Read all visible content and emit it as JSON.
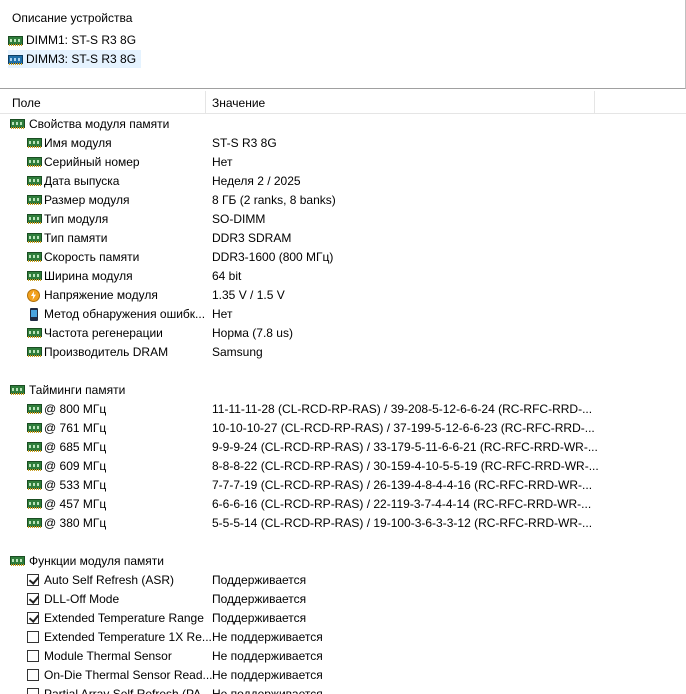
{
  "devices_panel": {
    "title": "Описание устройства",
    "devices": [
      {
        "label": "DIMM1: ST-S R3 8G",
        "selected": false
      },
      {
        "label": "DIMM3: ST-S R3 8G",
        "selected": true
      }
    ]
  },
  "columns": {
    "field": "Поле",
    "value": "Значение"
  },
  "sections": [
    {
      "title": "Свойства модуля памяти",
      "rows": [
        {
          "field": "Имя модуля",
          "value": "ST-S R3 8G",
          "icon": "ram"
        },
        {
          "field": "Серийный номер",
          "value": "Нет",
          "icon": "ram"
        },
        {
          "field": "Дата выпуска",
          "value": "Неделя 2 / 2025",
          "icon": "ram"
        },
        {
          "field": "Размер модуля",
          "value": "8 ГБ (2 ranks, 8 banks)",
          "icon": "ram"
        },
        {
          "field": "Тип модуля",
          "value": "SO-DIMM",
          "icon": "ram"
        },
        {
          "field": "Тип памяти",
          "value": "DDR3 SDRAM",
          "icon": "ram"
        },
        {
          "field": "Скорость памяти",
          "value": "DDR3-1600 (800 МГц)",
          "icon": "ram"
        },
        {
          "field": "Ширина модуля",
          "value": "64 bit",
          "icon": "ram"
        },
        {
          "field": "Напряжение модуля",
          "value": "1.35 V / 1.5 V",
          "icon": "voltage"
        },
        {
          "field": "Метод обнаружения ошибк...",
          "value": "Нет",
          "icon": "device"
        },
        {
          "field": "Частота регенерации",
          "value": "Норма (7.8 us)",
          "icon": "ram"
        },
        {
          "field": "Производитель DRAM",
          "value": "Samsung",
          "icon": "ram"
        }
      ]
    },
    {
      "title": "Тайминги памяти",
      "rows": [
        {
          "field": "@ 800 МГц",
          "value": "11-11-11-28  (CL-RCD-RP-RAS) / 39-208-5-12-6-6-24  (RC-RFC-RRD-...",
          "icon": "ram"
        },
        {
          "field": "@ 761 МГц",
          "value": "10-10-10-27  (CL-RCD-RP-RAS) / 37-199-5-12-6-6-23  (RC-RFC-RRD-...",
          "icon": "ram"
        },
        {
          "field": "@ 685 МГц",
          "value": "9-9-9-24  (CL-RCD-RP-RAS) / 33-179-5-11-6-6-21  (RC-RFC-RRD-WR-...",
          "icon": "ram"
        },
        {
          "field": "@ 609 МГц",
          "value": "8-8-8-22  (CL-RCD-RP-RAS) / 30-159-4-10-5-5-19  (RC-RFC-RRD-WR-...",
          "icon": "ram"
        },
        {
          "field": "@ 533 МГц",
          "value": "7-7-7-19  (CL-RCD-RP-RAS) / 26-139-4-8-4-4-16  (RC-RFC-RRD-WR-...",
          "icon": "ram"
        },
        {
          "field": "@ 457 МГц",
          "value": "6-6-6-16  (CL-RCD-RP-RAS) / 22-119-3-7-4-4-14  (RC-RFC-RRD-WR-...",
          "icon": "ram"
        },
        {
          "field": "@ 380 МГц",
          "value": "5-5-5-14  (CL-RCD-RP-RAS) / 19-100-3-6-3-3-12  (RC-RFC-RRD-WR-...",
          "icon": "ram"
        }
      ]
    },
    {
      "title": "Функции модуля памяти",
      "rows": [
        {
          "field": "Auto Self Refresh (ASR)",
          "value": "Поддерживается",
          "checked": true
        },
        {
          "field": "DLL-Off Mode",
          "value": "Поддерживается",
          "checked": true
        },
        {
          "field": "Extended Temperature Range",
          "value": "Поддерживается",
          "checked": true
        },
        {
          "field": "Extended Temperature 1X Re...",
          "value": "Не поддерживается",
          "checked": false
        },
        {
          "field": "Module Thermal Sensor",
          "value": "Не поддерживается",
          "checked": false
        },
        {
          "field": "On-Die Thermal Sensor Read...",
          "value": "Не поддерживается",
          "checked": false
        },
        {
          "field": "Partial Array Self Refresh (PA...",
          "value": "Не поддерживается",
          "checked": false
        }
      ]
    }
  ]
}
